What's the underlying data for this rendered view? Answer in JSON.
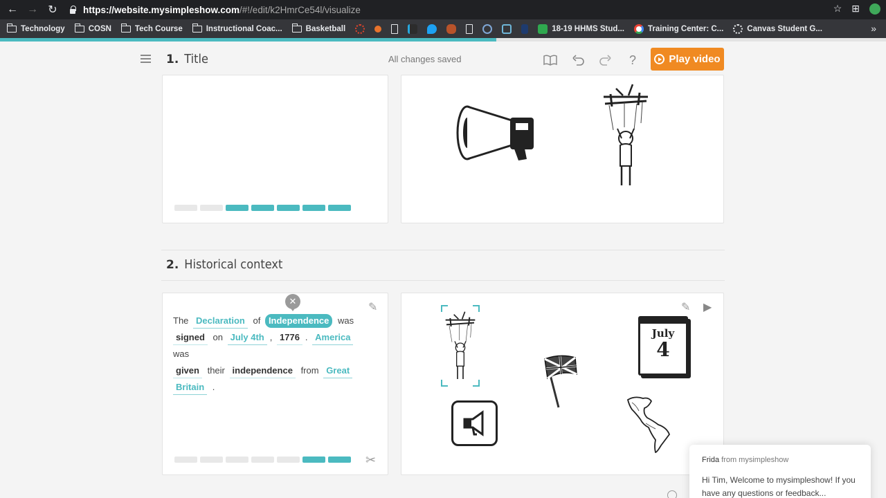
{
  "browser": {
    "url_host": "https://website.mysimpleshow.com",
    "url_path": "/#!/edit/k2HmrCe54l/visualize",
    "bookmarks": [
      {
        "label": "Technology",
        "kind": "folder"
      },
      {
        "label": "COSN",
        "kind": "folder"
      },
      {
        "label": "Tech Course",
        "kind": "folder"
      },
      {
        "label": "Instructional Coac...",
        "kind": "folder"
      },
      {
        "label": "Basketball",
        "kind": "folder"
      },
      {
        "label": "18-19 HHMS Stud...",
        "kind": "sheet"
      },
      {
        "label": "Training Center: C...",
        "kind": "google"
      },
      {
        "label": "Canvas Student G...",
        "kind": "canvas"
      }
    ],
    "more_label": "»"
  },
  "progress": {
    "fraction": 0.56
  },
  "toolbar": {
    "saved_status": "All changes saved",
    "play_label": "Play video",
    "help_label": "?"
  },
  "sections": [
    {
      "number": "1.",
      "title": "Title"
    },
    {
      "number": "2.",
      "title": "Historical context"
    }
  ],
  "section1": {
    "segments_total": 7,
    "segments_on": 5
  },
  "section2": {
    "script": {
      "t_the": "The",
      "k_declaration": "Declaration",
      "t_of": "of",
      "k_independence": "Independence",
      "t_was1": "was",
      "k_signed": "signed",
      "t_on": "on",
      "k_july4": "July 4th",
      "t_comma": ",",
      "k_1776": "1776",
      "t_dot1": ".",
      "k_america": "America",
      "t_was2": "was",
      "k_given": "given",
      "t_their": "their",
      "k_independence2": "independence",
      "t_from": "from",
      "k_great": "Great",
      "k_britain": "Britain",
      "t_dot2": "."
    },
    "segments_total": 7,
    "segments_on": 2,
    "calendar_month": "July",
    "calendar_day": "4"
  },
  "chat": {
    "sender": "Frida",
    "from_text": "from mysimpleshow",
    "message": "Hi Tim, Welcome to mysimpleshow! If you have any questions or feedback..."
  },
  "colors": {
    "accent": "#4bbac0",
    "cta": "#f08a22"
  }
}
